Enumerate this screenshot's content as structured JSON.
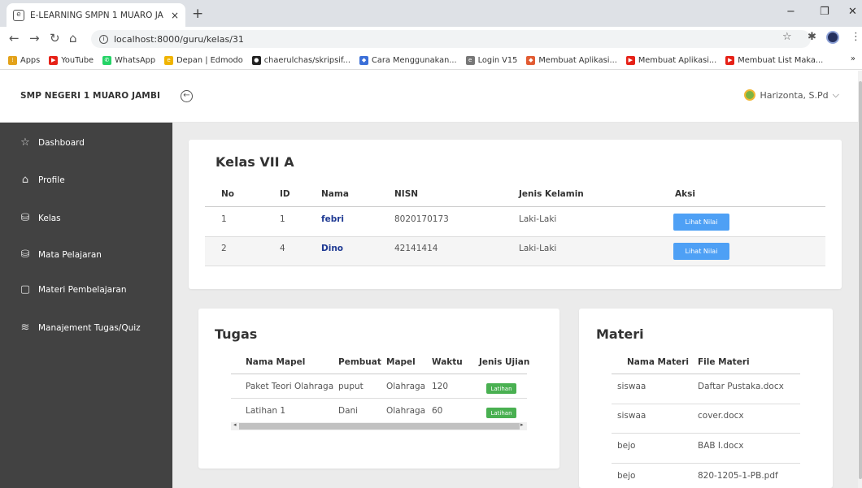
{
  "browser": {
    "tab_title": "E-LEARNING SMPN 1 MUARO JA",
    "tab_close": "×",
    "new_tab": "+",
    "url": "localhost:8000/guru/kelas/31",
    "bookmarks": [
      {
        "label": "Apps",
        "icon": "apps-icon",
        "color": "#e3a21a"
      },
      {
        "label": "YouTube",
        "icon": "youtube-icon",
        "color": "#e62117"
      },
      {
        "label": "WhatsApp",
        "icon": "whatsapp-icon",
        "color": "#25d366"
      },
      {
        "label": "Depan | Edmodo",
        "icon": "edmodo-icon",
        "color": "#f0b400"
      },
      {
        "label": "chaerulchas/skripsif...",
        "icon": "github-icon",
        "color": "#222222"
      },
      {
        "label": "Cara Menggunakan...",
        "icon": "bookmark-icon",
        "color": "#3b6fd8"
      },
      {
        "label": "Login V15",
        "icon": "page-icon",
        "color": "#777777"
      },
      {
        "label": "Membuat Aplikasi...",
        "icon": "bookmark-icon",
        "color": "#e25c33"
      },
      {
        "label": "Membuat Aplikasi...",
        "icon": "youtube-icon",
        "color": "#e62117"
      },
      {
        "label": "Membuat List Maka...",
        "icon": "youtube-icon",
        "color": "#e62117"
      }
    ],
    "bookmarks_more": "»"
  },
  "header": {
    "brand": "SMP NEGERI 1 MUARO JAMBI",
    "user_name": "Harizonta, S.Pd"
  },
  "sidebar": {
    "items": [
      {
        "label": "Dashboard",
        "icon": "star-icon"
      },
      {
        "label": "Profile",
        "icon": "home-icon"
      },
      {
        "label": "Kelas",
        "icon": "database-icon"
      },
      {
        "label": "Mata Pelajaran",
        "icon": "database-icon"
      },
      {
        "label": "Materi Pembelajaran",
        "icon": "square-icon"
      },
      {
        "label": "Manajement Tugas/Quiz",
        "icon": "layers-icon"
      }
    ]
  },
  "kelas": {
    "title": "Kelas VII A",
    "columns": [
      "No",
      "ID",
      "Nama",
      "NISN",
      "Jenis Kelamin",
      "Aksi"
    ],
    "rows": [
      {
        "no": "1",
        "id": "1",
        "nama": "febri",
        "nisn": "8020170173",
        "jk": "Laki-Laki",
        "aksi": "Lihat Nilai"
      },
      {
        "no": "2",
        "id": "4",
        "nama": "Dino",
        "nisn": "42141414",
        "jk": "Laki-Laki",
        "aksi": "Lihat Nilai"
      }
    ]
  },
  "tugas": {
    "title": "Tugas",
    "columns": [
      "Nama Mapel",
      "Pembuat",
      "Mapel",
      "Waktu",
      "Jenis Ujian"
    ],
    "rows": [
      {
        "nama": "Paket Teori Olahraga",
        "pembuat": "puput",
        "mapel": "Olahraga",
        "waktu": "120",
        "jenis": "Latihan"
      },
      {
        "nama": "Latihan 1",
        "pembuat": "Dani",
        "mapel": "Olahraga",
        "waktu": "60",
        "jenis": "Latihan"
      }
    ]
  },
  "materi": {
    "title": "Materi",
    "columns": [
      "Nama Materi",
      "File Materi"
    ],
    "rows": [
      {
        "nama": "siswaa",
        "file": "Daftar Pustaka.docx"
      },
      {
        "nama": "siswaa",
        "file": "cover.docx"
      },
      {
        "nama": "bejo",
        "file": "BAB I.docx"
      },
      {
        "nama": "bejo",
        "file": "820-1205-1-PB.pdf"
      }
    ]
  },
  "colors": {
    "sidebar": "#424242",
    "button": "#4ea0f5",
    "badge": "#49b051",
    "link": "#1f3a93"
  }
}
